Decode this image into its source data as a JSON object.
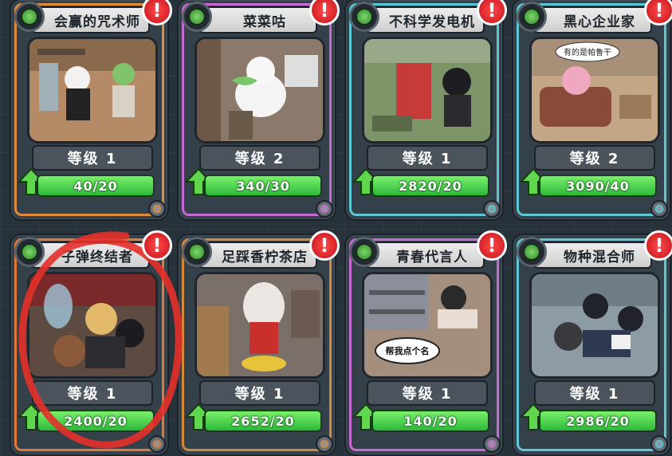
{
  "cards": [
    {
      "title": "会赢的咒术师",
      "level": "等级 1",
      "exp": "40/20",
      "rim": "#e08a3b",
      "scene": "#b98e67"
    },
    {
      "title": "菜菜咕",
      "level": "等级 2",
      "exp": "340/30",
      "rim": "#c76ad4",
      "scene": "#8c7a6a"
    },
    {
      "title": "不科学发电机",
      "level": "等级 1",
      "exp": "2820/20",
      "rim": "#5ec7d6",
      "scene": "#6e8a5f"
    },
    {
      "title": "黑心企业家",
      "level": "等级 2",
      "exp": "3090/40",
      "rim": "#5ec7d6",
      "scene": "#b89a7e"
    },
    {
      "title": "子弹终结者",
      "level": "等级 1",
      "exp": "2400/20",
      "rim": "#e07a3b",
      "scene": "#6a5448"
    },
    {
      "title": "足踩香柠茶店",
      "level": "等级 1",
      "exp": "2652/20",
      "rim": "#d38a3b",
      "scene": "#7a6f69"
    },
    {
      "title": "青春代言人",
      "level": "等级 1",
      "exp": "140/20",
      "rim": "#c76ad4",
      "scene": "#a48f7f"
    },
    {
      "title": "物种混合师",
      "level": "等级 1",
      "exp": "2986/20",
      "rim": "#5ec7d6",
      "scene": "#8c9aa3"
    }
  ],
  "speech_bubbles": {
    "card4": "有的是帕鲁干",
    "card7": "帮我点个名"
  },
  "alert_symbol": "!",
  "annotation_color": "#e5302a"
}
